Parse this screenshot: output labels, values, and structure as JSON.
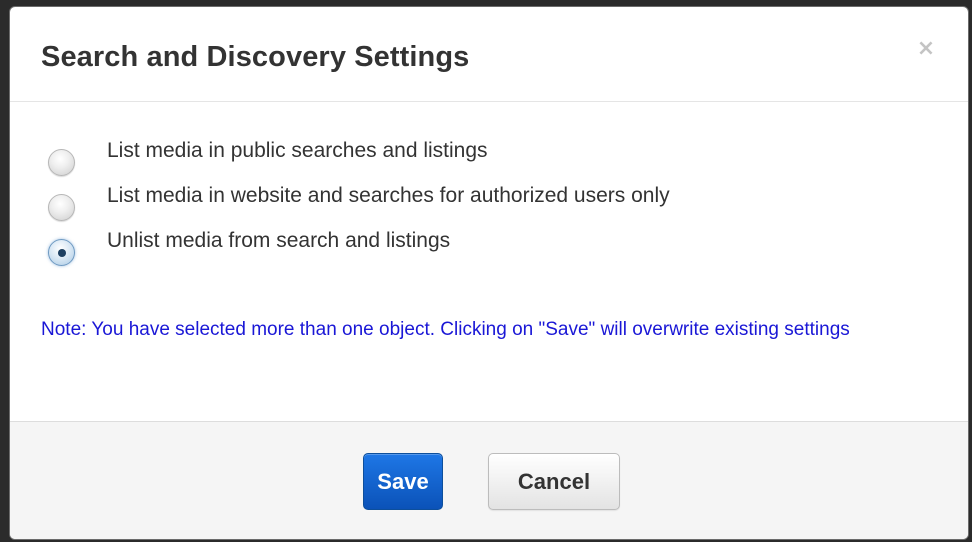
{
  "dialog": {
    "title": "Search and Discovery Settings",
    "close_label": "×"
  },
  "options": [
    {
      "label": "List media in public searches and listings",
      "selected": false
    },
    {
      "label": "List media in website and searches for authorized users only",
      "selected": false
    },
    {
      "label": "Unlist media from search and listings",
      "selected": true
    }
  ],
  "note": "Note: You have selected more than one object. Clicking on \"Save\" will overwrite existing settings",
  "footer": {
    "save_label": "Save",
    "cancel_label": "Cancel"
  },
  "colors": {
    "note_text": "#1a17d6",
    "primary_button": "#0b52b8",
    "title_text": "#333333"
  }
}
